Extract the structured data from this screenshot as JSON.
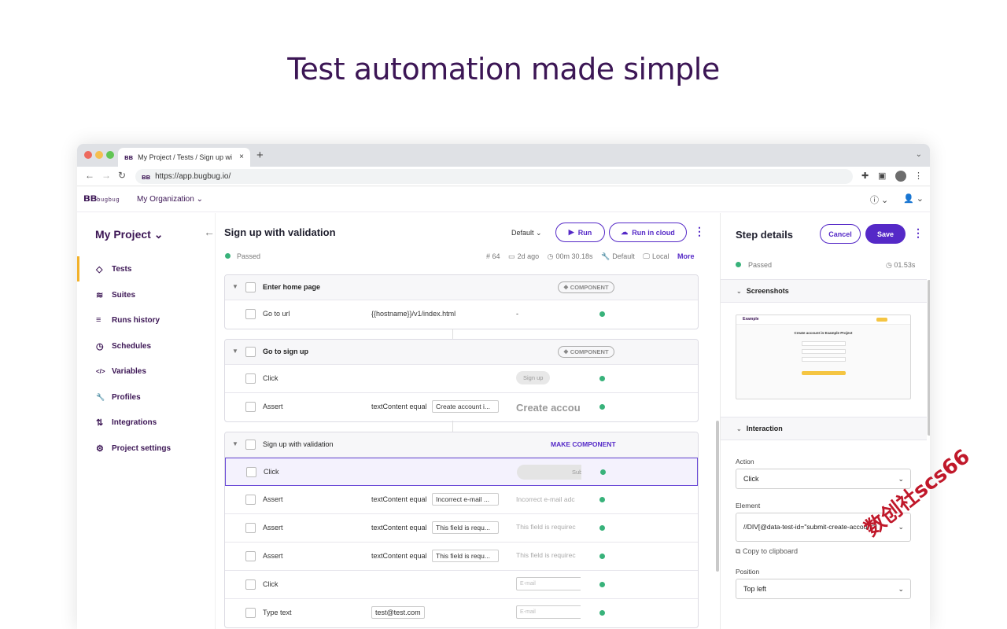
{
  "hero": {
    "title": "Test automation made simple"
  },
  "browser": {
    "tab_title": "My Project / Tests / Sign up wi",
    "tab_close": "×",
    "new_tab": "+",
    "url": "https://app.bugbug.io/",
    "traffic_colors": [
      "#ed6a5e",
      "#f5bf4f",
      "#61c554"
    ]
  },
  "app": {
    "logo": "bugbug",
    "organization": "My Organization"
  },
  "sidebar": {
    "project": "My Project",
    "items": [
      {
        "label": "Tests",
        "icon": "diamond-icon",
        "glyph": "◇"
      },
      {
        "label": "Suites",
        "icon": "layers-icon",
        "glyph": "≋"
      },
      {
        "label": "Runs history",
        "icon": "history-list-icon",
        "glyph": "≡"
      },
      {
        "label": "Schedules",
        "icon": "clock-icon",
        "glyph": "◷"
      },
      {
        "label": "Variables",
        "icon": "code-icon",
        "glyph": "</>"
      },
      {
        "label": "Profiles",
        "icon": "wrench-icon",
        "glyph": "🔧"
      },
      {
        "label": "Integrations",
        "icon": "integration-icon",
        "glyph": "⇅"
      },
      {
        "label": "Project settings",
        "icon": "gear-icon",
        "glyph": "⚙"
      }
    ]
  },
  "test": {
    "title": "Sign up with validation",
    "profile": "Default",
    "run_label": "Run",
    "run_cloud_label": "Run in cloud",
    "status": "Passed",
    "run_number": "# 64",
    "ago": "2d ago",
    "duration": "00m 30.18s",
    "profile_meta": "Default",
    "env": "Local",
    "more": "More"
  },
  "groups": [
    {
      "name": "Enter home page",
      "badge": "❖ COMPONENT",
      "steps": [
        {
          "name": "Go to url",
          "param": "{{hostname}}/v1/index.html",
          "value": "",
          "preview": "-"
        }
      ]
    },
    {
      "name": "Go to sign up",
      "badge": "❖ COMPONENT",
      "steps": [
        {
          "name": "Click",
          "param": "",
          "value": "",
          "preview": "Sign up"
        },
        {
          "name": "Assert",
          "param": "textContent equal",
          "value": "Create account i...",
          "preview": "Create accou"
        }
      ]
    },
    {
      "name": "Sign up with validation",
      "badge": "MAKE COMPONENT",
      "steps": [
        {
          "name": "Click",
          "param": "",
          "value": "",
          "preview": "Sub"
        },
        {
          "name": "Assert",
          "param": "textContent equal",
          "value": "Incorrect e-mail ...",
          "preview": "Incorrect e-mail adc"
        },
        {
          "name": "Assert",
          "param": "textContent equal",
          "value": "This field is requ...",
          "preview": "This field is requirec"
        },
        {
          "name": "Assert",
          "param": "textContent equal",
          "value": "This field is requ...",
          "preview": "This field is requirec"
        },
        {
          "name": "Click",
          "param": "",
          "value": "",
          "preview": "E-mail"
        },
        {
          "name": "Type text",
          "param": "test@test.com",
          "value": "",
          "preview": "E-mail"
        }
      ]
    }
  ],
  "panel": {
    "title": "Step details",
    "cancel": "Cancel",
    "save": "Save",
    "status": "Passed",
    "duration": "01.53s",
    "screenshots": "Screenshots",
    "interaction": "Interaction",
    "action_label": "Action",
    "action_value": "Click",
    "element_label": "Element",
    "element_value": "//DIV[@data-test-id=\"submit-create-account\"]",
    "copy": "Copy to clipboard",
    "position_label": "Position",
    "position_value": "Top left",
    "screenshot_heading": "Create account in Example Project",
    "screenshot_logo": "Example"
  },
  "watermark": "数创社scs66"
}
